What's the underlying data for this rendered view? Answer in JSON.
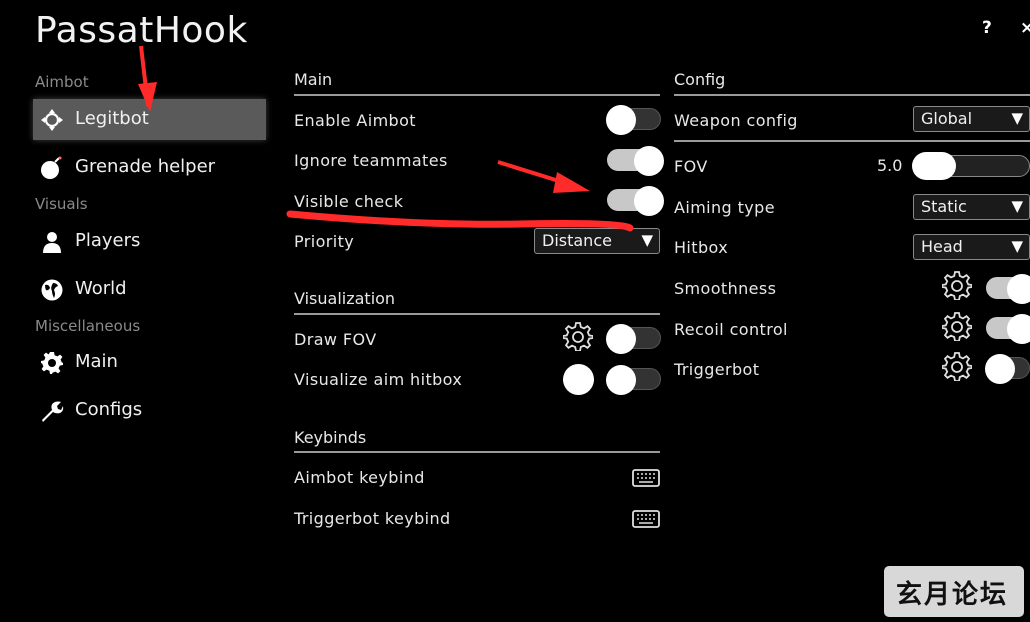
{
  "app": {
    "title": "PassatHook",
    "help_label": "?",
    "close_label": "×"
  },
  "sidebar": {
    "categories": [
      "Aimbot",
      "Visuals",
      "Miscellaneous"
    ],
    "items": [
      {
        "label": "Legitbot",
        "icon": "crosshair-icon",
        "active": true
      },
      {
        "label": "Grenade helper",
        "icon": "grenade-icon"
      },
      {
        "label": "Players",
        "icon": "user-icon"
      },
      {
        "label": "World",
        "icon": "globe-icon"
      },
      {
        "label": "Main",
        "icon": "gear-icon"
      },
      {
        "label": "Configs",
        "icon": "wrench-icon"
      }
    ]
  },
  "main_section": {
    "title": "Main",
    "enable_aimbot": {
      "label": "Enable Aimbot",
      "on": false
    },
    "ignore_teammates": {
      "label": "Ignore teammates",
      "on": true
    },
    "visible_check": {
      "label": "Visible check",
      "on": true
    },
    "priority": {
      "label": "Priority",
      "value": "Distance"
    }
  },
  "visualization": {
    "title": "Visualization",
    "draw_fov": {
      "label": "Draw FOV",
      "on": false
    },
    "visualize_hitbox": {
      "label": "Visualize aim hitbox",
      "on": false
    }
  },
  "keybinds": {
    "title": "Keybinds",
    "aimbot": {
      "label": "Aimbot keybind"
    },
    "triggerbot": {
      "label": "Triggerbot keybind"
    }
  },
  "config": {
    "title": "Config",
    "weapon_config": {
      "label": "Weapon config",
      "value": "Global"
    },
    "fov": {
      "label": "FOV",
      "value": "5.0"
    },
    "aiming_type": {
      "label": "Aiming type",
      "value": "Static"
    },
    "hitbox": {
      "label": "Hitbox",
      "value": "Head"
    },
    "smoothness": {
      "label": "Smoothness",
      "on": true
    },
    "recoil_control": {
      "label": "Recoil control",
      "on": true
    },
    "triggerbot": {
      "label": "Triggerbot",
      "on": false
    }
  },
  "dropdown_arrow": "▼",
  "watermark": "玄月论坛",
  "colors": {
    "background": "#000000",
    "active_item": "#5a5a5a",
    "annotation": "#ff2a2a"
  }
}
